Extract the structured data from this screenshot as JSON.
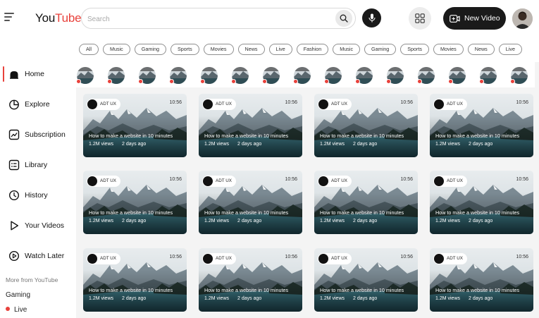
{
  "header": {
    "logo_you": "You",
    "logo_tube": "Tube",
    "search_placeholder": "Search",
    "new_video_label": "New Video",
    "icons": [
      "menu-icon",
      "search-icon",
      "mic-icon",
      "apps-grid-icon",
      "video-add-icon",
      "user-avatar"
    ]
  },
  "chips": [
    "All",
    "Music",
    "Gaming",
    "Sports",
    "Movies",
    "News",
    "Live",
    "Fashion",
    "Music",
    "Gaming",
    "Sports",
    "Movies",
    "News",
    "Live"
  ],
  "sidebar": {
    "items": [
      {
        "label": "Home",
        "icon": "home-icon",
        "active": true
      },
      {
        "label": "Explore",
        "icon": "explore-icon",
        "active": false
      },
      {
        "label": "Subscription",
        "icon": "subscription-icon",
        "active": false
      },
      {
        "label": "Library",
        "icon": "library-icon",
        "active": false
      },
      {
        "label": "History",
        "icon": "history-icon",
        "active": false
      },
      {
        "label": "Your Videos",
        "icon": "your-videos-icon",
        "active": false
      },
      {
        "label": "Watch Later",
        "icon": "watch-later-icon",
        "active": false
      }
    ],
    "more_label": "More from YouTube",
    "more_items": [
      {
        "label": "Gaming"
      },
      {
        "label": "Live",
        "live_indicator": true
      }
    ]
  },
  "stories_count": 15,
  "videos": [
    {
      "channel": "ADT UX",
      "duration": "10:56",
      "title": "How to make a website in 10 minutes",
      "views": "1.2M views",
      "age": "2 days ago"
    },
    {
      "channel": "ADT UX",
      "duration": "10:56",
      "title": "How to make a website in 10 minutes",
      "views": "1.2M views",
      "age": "2 days ago"
    },
    {
      "channel": "ADT UX",
      "duration": "10:56",
      "title": "How to make a website in 10 minutes",
      "views": "1.2M views",
      "age": "2 days ago"
    },
    {
      "channel": "ADT UX",
      "duration": "10:56",
      "title": "How to make a website in 10 minutes",
      "views": "1.2M views",
      "age": "2 days ago"
    },
    {
      "channel": "ADT UX",
      "duration": "10:56",
      "title": "How to make a website in 10 minutes",
      "views": "1.2M views",
      "age": "2 days ago"
    },
    {
      "channel": "ADT UX",
      "duration": "10:56",
      "title": "How to make a website in 10 minutes",
      "views": "1.2M views",
      "age": "2 days ago"
    },
    {
      "channel": "ADT UX",
      "duration": "10:56",
      "title": "How to make a website in 10 minutes",
      "views": "1.2M views",
      "age": "2 days ago"
    },
    {
      "channel": "ADT UX",
      "duration": "10:56",
      "title": "How to make a website in 10 minutes",
      "views": "1.2M views",
      "age": "2 days ago"
    },
    {
      "channel": "ADT UX",
      "duration": "10:56",
      "title": "How to make a website in 10 minutes",
      "views": "1.2M views",
      "age": "2 days ago"
    },
    {
      "channel": "ADT UX",
      "duration": "10:56",
      "title": "How to make a website in 10 minutes",
      "views": "1.2M views",
      "age": "2 days ago"
    },
    {
      "channel": "ADT UX",
      "duration": "10:56",
      "title": "How to make a website in 10 minutes",
      "views": "1.2M views",
      "age": "2 days ago"
    },
    {
      "channel": "ADT UX",
      "duration": "10:56",
      "title": "How to make a website in 10 minutes",
      "views": "1.2M views",
      "age": "2 days ago"
    }
  ],
  "colors": {
    "accent": "#e8413b",
    "dark": "#1a1a1a",
    "content_bg": "#f4f4f4"
  }
}
